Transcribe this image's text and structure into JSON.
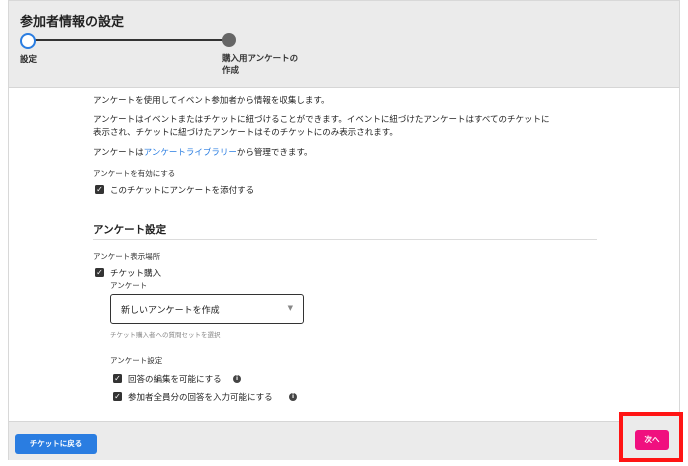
{
  "header": {
    "title": "参加者情報の設定",
    "steps": [
      {
        "label": "設定"
      },
      {
        "label": "購入用アンケートの作成"
      }
    ]
  },
  "content": {
    "intro_1": "アンケートを使用してイベント参加者から情報を収集します。",
    "intro_2_line1": "アンケートはイベントまたはチケットに紐づけることができます。イベントに紐づけたアンケートはすべてのチケットに",
    "intro_2_line2": "表示され、チケットに紐づけたアンケートはそのチケットにのみ表示されます。",
    "intro_3_prefix": "アンケートは",
    "intro_3_link": "アンケートライブラリー",
    "intro_3_suffix": "から管理できます。",
    "enable_label": "アンケートを有効にする",
    "attach_checkbox_label": "このチケットにアンケートを添付する",
    "section_title": "アンケート設定",
    "display_location_label": "アンケート表示場所",
    "ticket_purchase_label": "チケット購入",
    "survey_field_label": "アンケート",
    "survey_select_value": "新しいアンケートを作成",
    "survey_select_hint": "チケット購入者への質問セットを選択",
    "settings_label": "アンケート設定",
    "allow_edit_label": "回答の編集を可能にする",
    "all_participants_label": "参加者全員分の回答を入力可能にする"
  },
  "footer": {
    "back_label": "チケットに戻る",
    "next_label": "次へ"
  },
  "colors": {
    "primary": "#2a7de1",
    "accent": "#f0107f",
    "highlight": "#ff1414"
  }
}
